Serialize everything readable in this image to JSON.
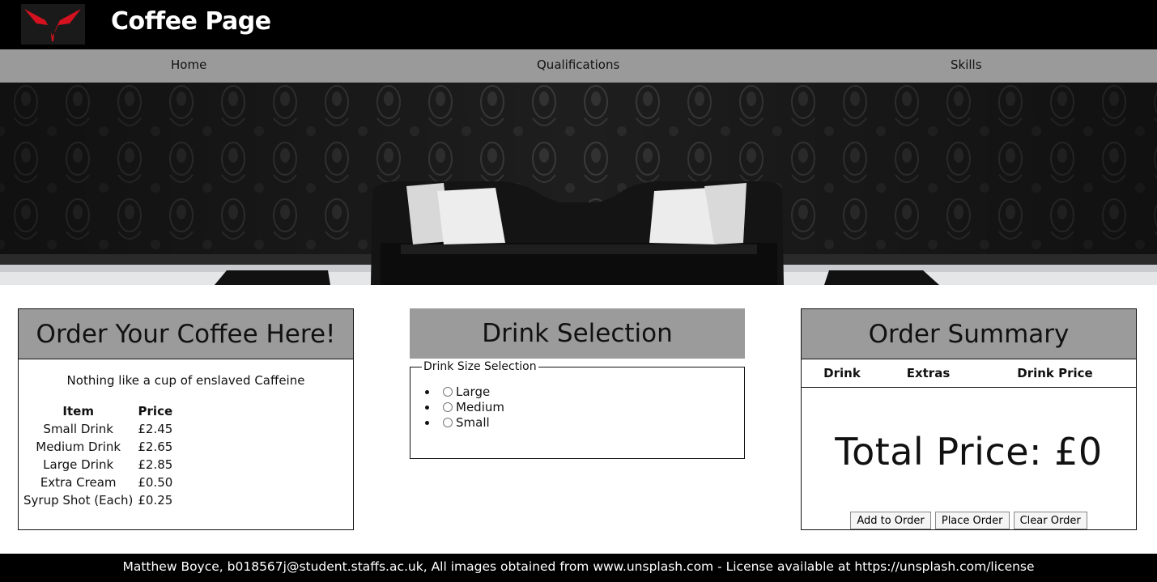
{
  "header": {
    "title": "Coffee Page",
    "logo_icon": "red-v-logo-icon"
  },
  "nav": {
    "items": [
      {
        "label": "Home"
      },
      {
        "label": "Qualifications"
      },
      {
        "label": "Skills"
      }
    ]
  },
  "hero": {
    "image": "black-sofa-damask-wall-photo"
  },
  "menu_panel": {
    "title": "Order Your Coffee Here!",
    "tagline": "Nothing like a cup of enslaved Caffeine",
    "headers": {
      "item": "Item",
      "price": "Price"
    },
    "rows": [
      {
        "item": "Small Drink",
        "price": "£2.45"
      },
      {
        "item": "Medium Drink",
        "price": "£2.65"
      },
      {
        "item": "Large Drink",
        "price": "£2.85"
      },
      {
        "item": "Extra Cream",
        "price": "£0.50"
      },
      {
        "item": "Syrup Shot (Each)",
        "price": "£0.25"
      }
    ]
  },
  "drink_panel": {
    "title": "Drink Selection",
    "legend": "Drink Size Selection",
    "options": [
      {
        "label": "Large"
      },
      {
        "label": "Medium"
      },
      {
        "label": "Small"
      }
    ]
  },
  "summary_panel": {
    "title": "Order Summary",
    "headers": {
      "drink": "Drink",
      "extras": "Extras",
      "price": "Drink Price"
    },
    "total": "Total Price: £0",
    "buttons": {
      "add": "Add to Order",
      "place": "Place Order",
      "clear": "Clear Order"
    }
  },
  "footer": {
    "text": "Matthew Boyce, b018567j@student.staffs.ac.uk, All images obtained from www.unsplash.com - License available at https://unsplash.com/license"
  },
  "colors": {
    "header_bg": "#000000",
    "nav_bg": "#9a9a9a",
    "panel_head_bg": "#9b9b9b",
    "logo_red": "#d4121f"
  }
}
